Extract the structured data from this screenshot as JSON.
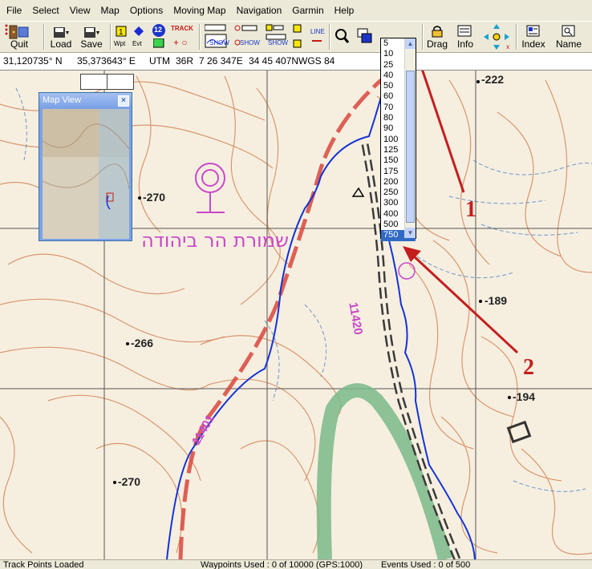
{
  "menu": [
    "File",
    "Select",
    "View",
    "Map",
    "Options",
    "Moving Map",
    "Navigation",
    "Garmin",
    "Help"
  ],
  "toolbar": {
    "quit": "Quit",
    "load": "Load",
    "save": "Save",
    "wpt": "Wpt",
    "evt": "Evt",
    "track_badge": "12",
    "track": "TRACK",
    "show1": "SHOW",
    "show2": "SHOW",
    "show3": "SHOW",
    "line": "LINE",
    "drag": "Drag",
    "info": "Info",
    "index": "Index",
    "name": "Name"
  },
  "zoom": {
    "current": "100",
    "options": [
      "5",
      "10",
      "25",
      "40",
      "50",
      "60",
      "70",
      "80",
      "90",
      "100",
      "125",
      "150",
      "175",
      "200",
      "250",
      "300",
      "400",
      "500",
      "750"
    ],
    "highlighted": "750"
  },
  "coords": {
    "lat": "31,120735° N",
    "lon": "35,373643° E",
    "utm_label": "UTM",
    "zone": "36R",
    "easting": "7 26 347E",
    "northing": "34 45 407N",
    "datum": "WGS 84"
  },
  "mapview": {
    "title": "Map View"
  },
  "map_labels": {
    "e222": "-222",
    "e270a": "-270",
    "e189": "-189",
    "e266": "-266",
    "e194": "-194",
    "e270b": "-270",
    "road1": "11420",
    "road2": "11401",
    "hebrew": "שמורת הר ביהודה",
    "ann1": "1",
    "ann2": "2"
  },
  "status": {
    "left": "Track Points Loaded",
    "waypoints": "Waypoints Used : 0 of 10000  (GPS:1000)",
    "events": "Events Used : 0 of 500"
  },
  "colors": {
    "contour": "#d6875a",
    "route_blue": "#1433d6",
    "road_red": "#d9463c",
    "green_band": "#7ab888",
    "annotation": "#c41e1e",
    "magenta": "#c947c9",
    "grid": "#555555"
  }
}
